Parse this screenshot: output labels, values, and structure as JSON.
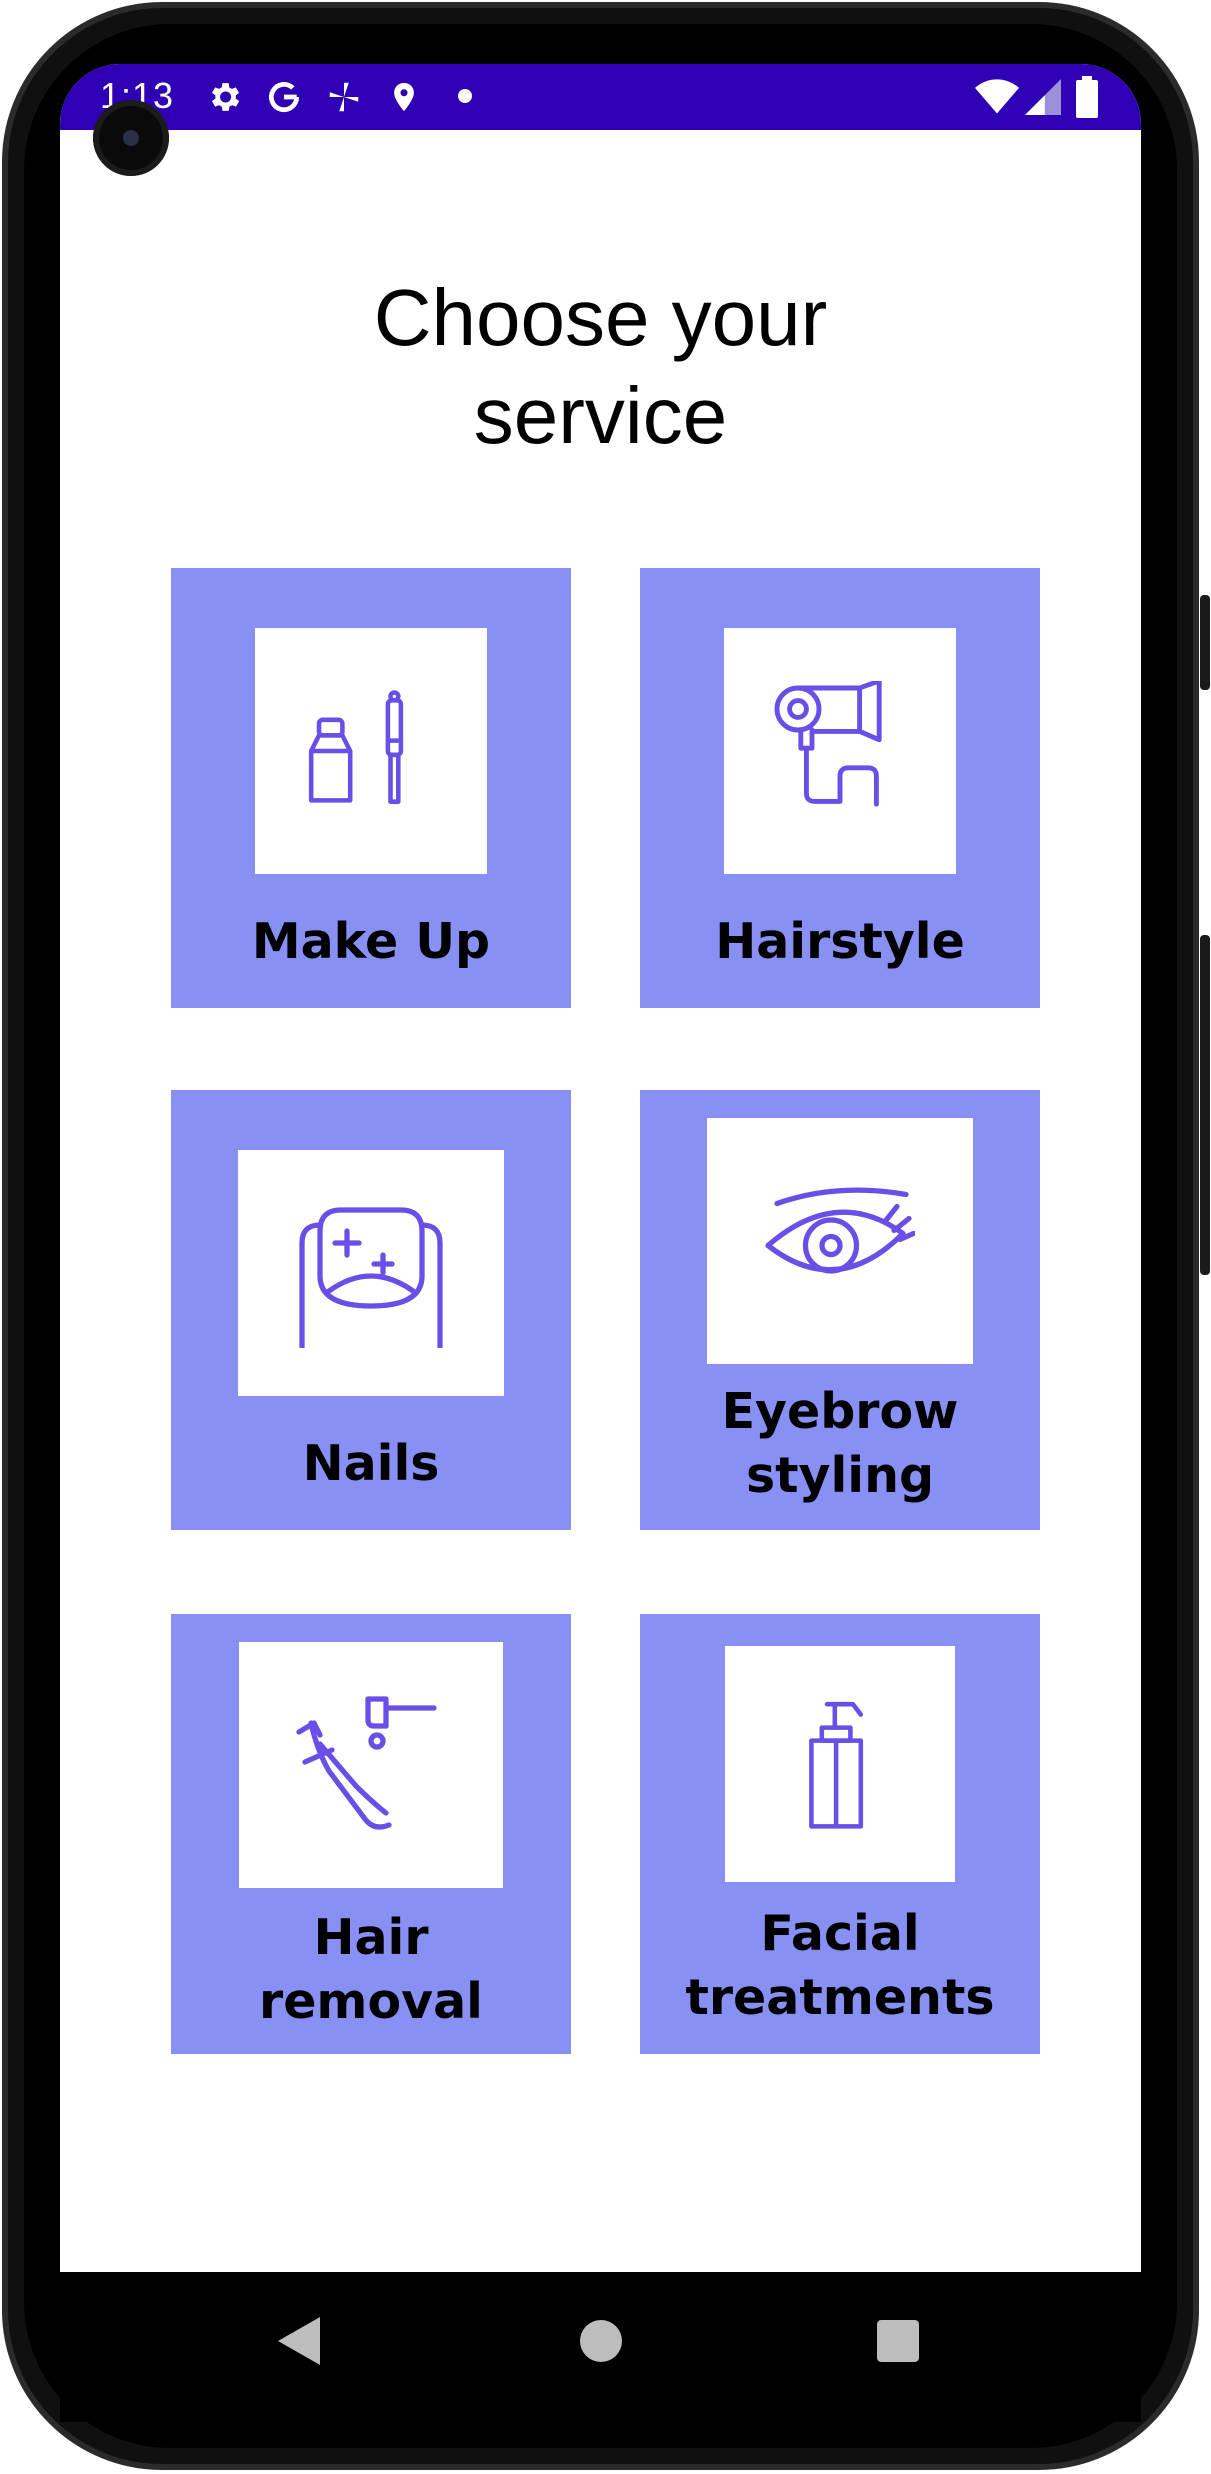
{
  "status_bar": {
    "time": "1:13",
    "background": "#2f00b4",
    "left_icons": [
      "settings-icon",
      "google-icon",
      "pinwheel-icon",
      "location-icon",
      "dot-icon"
    ],
    "right_icons": [
      "wifi-icon",
      "signal-icon",
      "battery-icon"
    ]
  },
  "page": {
    "title_line1": "Choose your",
    "title_line2": "service"
  },
  "services": [
    {
      "label_line1": "Make Up",
      "label_line2": "",
      "icon": "nail-polish-icon"
    },
    {
      "label_line1": "Hairstyle",
      "label_line2": "",
      "icon": "hair-dryer-icon"
    },
    {
      "label_line1": "Nails",
      "label_line2": "",
      "icon": "nail-icon"
    },
    {
      "label_line1": "Eyebrow",
      "label_line2": "styling",
      "icon": "eye-icon"
    },
    {
      "label_line1": "Hair",
      "label_line2": "removal",
      "icon": "epilator-icon"
    },
    {
      "label_line1": "Facial",
      "label_line2": "treatments",
      "icon": "pump-bottle-icon"
    }
  ],
  "navigation": {
    "back": "back-icon",
    "home": "home-icon",
    "recents": "recents-icon"
  },
  "colors": {
    "tile": "#8891f3",
    "icon_stroke": "#6a4ee8",
    "status_bar": "#2f00b4"
  }
}
